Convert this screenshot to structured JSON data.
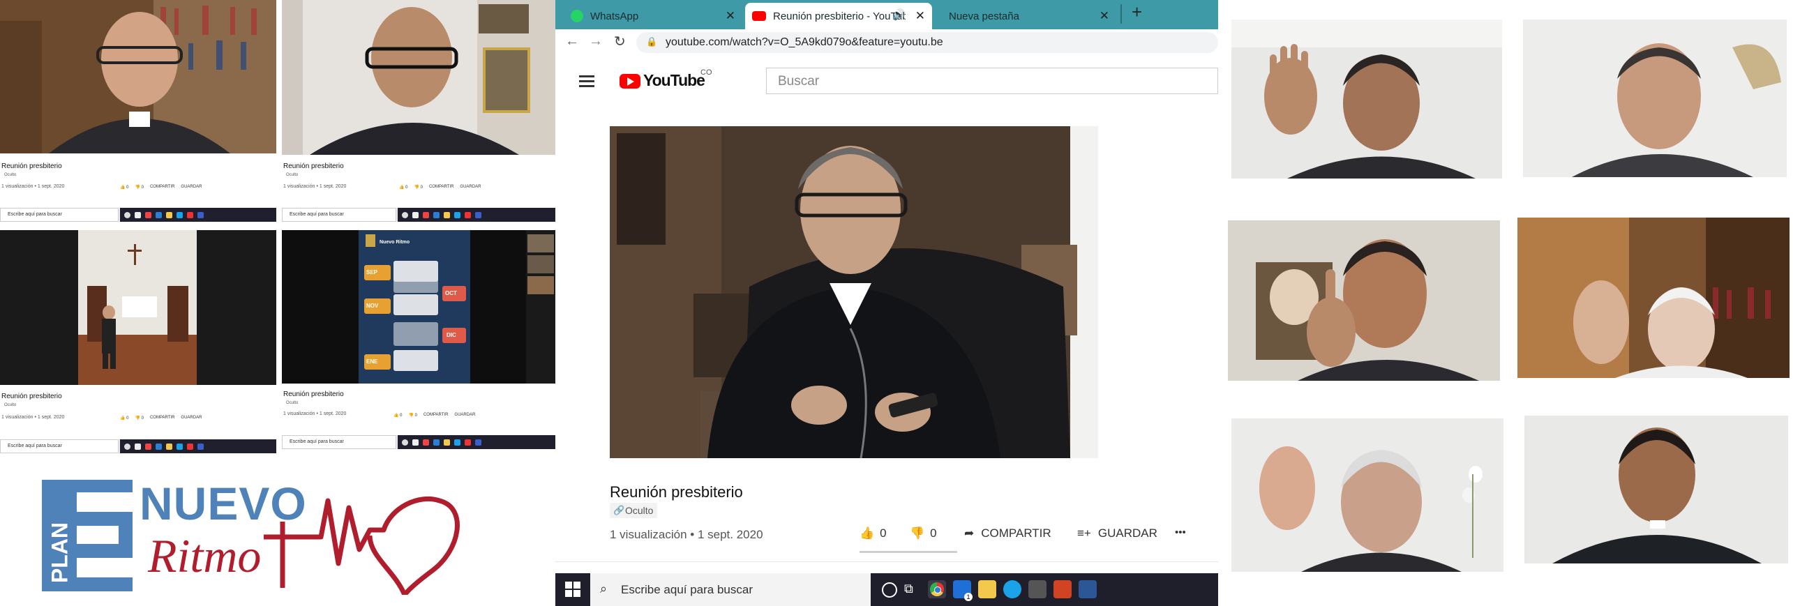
{
  "thumbnails": [
    {
      "title": "Reunión presbiterio",
      "hidden_label": "Oculto",
      "views": "1 visualización • 1 sept. 2020",
      "likes": "0",
      "dislikes": "0",
      "share": "COMPARTIR",
      "save": "GUARDAR",
      "search": "Escribe aquí para buscar"
    },
    {
      "title": "Reunión presbiterio",
      "hidden_label": "Oculto",
      "views": "1 visualización • 1 sept. 2020",
      "likes": "0",
      "dislikes": "0",
      "share": "COMPARTIR",
      "save": "GUARDAR",
      "search": "Escribe aquí para buscar"
    },
    {
      "title": "Reunión presbiterio",
      "hidden_label": "Oculto",
      "views": "1 visualización • 1 sept. 2020",
      "likes": "0",
      "dislikes": "0",
      "share": "COMPARTIR",
      "save": "GUARDAR",
      "search": "Escribe aquí para buscar"
    },
    {
      "title": "Reunión presbiterio",
      "hidden_label": "Oculto",
      "views": "1 visualización • 1 sept. 2020",
      "likes": "0",
      "dislikes": "0",
      "share": "COMPARTIR",
      "save": "GUARDAR",
      "search": "Escribe aquí para buscar",
      "slide": {
        "heading": "Nuevo Ritmo",
        "months": [
          "SEP",
          "NOV",
          "ENE",
          "OCT",
          "DIC"
        ]
      }
    }
  ],
  "browser": {
    "tabs": [
      {
        "label": "WhatsApp",
        "icon": "whatsapp-icon"
      },
      {
        "label": "Reunión presbiterio - YouTube",
        "icon": "youtube-icon"
      },
      {
        "label": "Nueva pestaña",
        "icon": ""
      }
    ],
    "new_tab": "+",
    "url": "youtube.com/watch?v=O_5A9kd079o&feature=youtu.be"
  },
  "youtube": {
    "logo_text": "YouTube",
    "region": "CO",
    "search_placeholder": "Buscar",
    "video_title": "Reunión presbiterio",
    "visibility": "Oculto",
    "views": "1 visualización • 1 sept. 2020",
    "likes": "0",
    "dislikes": "0",
    "share": "COMPARTIR",
    "save": "GUARDAR",
    "more": "•••"
  },
  "taskbar": {
    "search_placeholder": "Escribe aquí para buscar",
    "mail_badge": "1"
  },
  "logo": {
    "plan": "PLAN",
    "letter": "E",
    "nuevo": "NUEVO",
    "ritmo": "Ritmo",
    "colors": {
      "blue": "#4f82b8",
      "red": "#b01e2e"
    }
  },
  "colors": {
    "tabbar": "#3d9aa6",
    "youtube_red": "#ff0000",
    "taskbar": "#1f1f2b"
  }
}
